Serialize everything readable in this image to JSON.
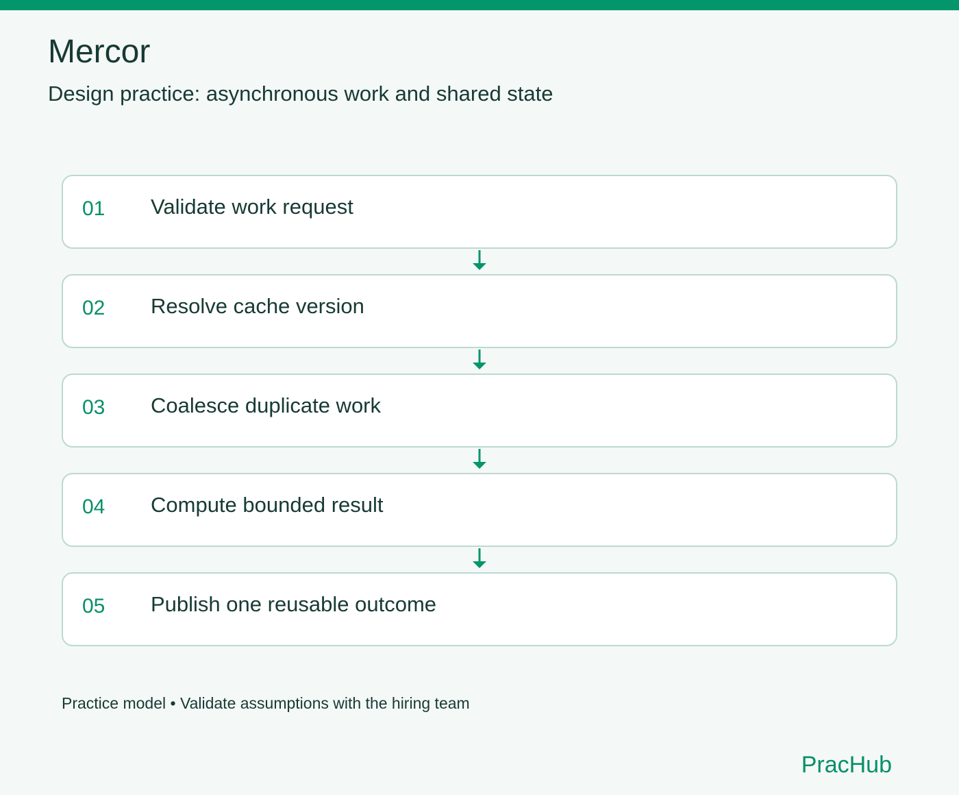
{
  "header": {
    "title": "Mercor",
    "subtitle": "Design practice: asynchronous work and shared state"
  },
  "steps": [
    {
      "number": "01",
      "label": "Validate work request"
    },
    {
      "number": "02",
      "label": "Resolve cache version"
    },
    {
      "number": "03",
      "label": "Coalesce duplicate work"
    },
    {
      "number": "04",
      "label": "Compute bounded result"
    },
    {
      "number": "05",
      "label": "Publish one reusable outcome"
    }
  ],
  "footer": {
    "note": "Practice model • Validate assumptions with the hiring team",
    "brand": "PracHub"
  },
  "icons": {
    "flow_arrow": "arrow-down-icon"
  },
  "colors": {
    "accent": "#03956b",
    "accent_text": "#078f68",
    "background": "#f4f8f7",
    "card_background": "#ffffff",
    "card_border": "#bcd9d1",
    "text": "#173a33"
  }
}
